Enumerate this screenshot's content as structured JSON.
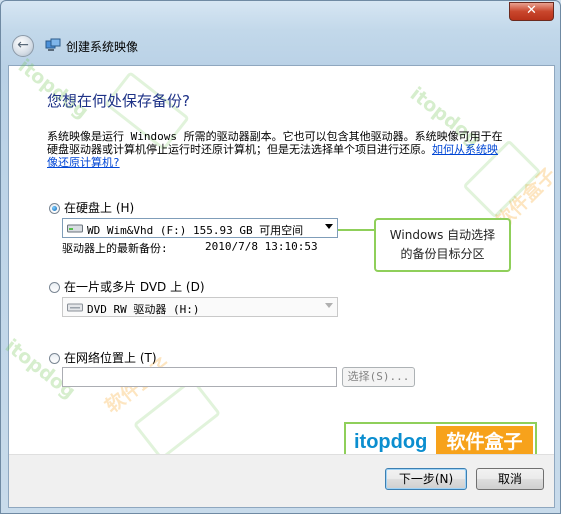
{
  "window": {
    "title": "创建系统映像",
    "close_label": "✕"
  },
  "heading": "您想在何处保存备份?",
  "description": {
    "text": "系统映像是运行 Windows 所需的驱动器副本。它也可以包含其他驱动器。系统映像可用于在硬盘驱动器或计算机停止运行时还原计算机；但是无法选择单个项目进行还原。",
    "link": "如何从系统映像还原计算机?"
  },
  "options": {
    "hard_disk": {
      "label": "在硬盘上 (H)",
      "selected": true,
      "drive_value": "WD Wim&Vhd (F:)  155.93 GB 可用空间",
      "latest_backup_label": "驱动器上的最新备份:",
      "latest_backup_value": "2010/7/8 13:10:53"
    },
    "dvd": {
      "label": "在一片或多片 DVD 上 (D)",
      "selected": false,
      "drive_value": "DVD RW 驱动器 (H:)"
    },
    "network": {
      "label": "在网络位置上 (T)",
      "selected": false,
      "path_value": "",
      "browse_label": "选择(S)..."
    }
  },
  "callout": {
    "line1": "Windows 自动选择",
    "line2": "的备份目标分区"
  },
  "watermark": {
    "brand_a": "itopdog",
    "brand_b": "软件盒子",
    "accent_green": "#8fcf5a",
    "accent_orange": "#f7a21b",
    "accent_blue": "#0b8ecf"
  },
  "buttons": {
    "next": "下一步(N)",
    "cancel": "取消"
  }
}
